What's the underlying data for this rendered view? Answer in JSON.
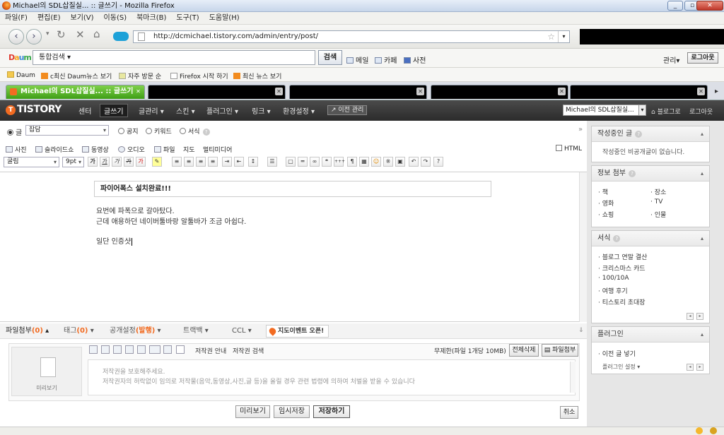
{
  "window": {
    "title": "Michael의 SDL삽질실... :: 글쓰기 - Mozilla Firefox"
  },
  "menu": [
    "파일(F)",
    "편집(E)",
    "보기(V)",
    "이동(S)",
    "북마크(B)",
    "도구(T)",
    "도움말(H)"
  ],
  "nav": {
    "url": "http://dcmichael.tistory.com/admin/entry/post/"
  },
  "daum": {
    "logo": "Daum",
    "search_label": "통합검색",
    "search_button": "검색",
    "links": [
      "메일",
      "카페",
      "사전"
    ],
    "manage": "관리",
    "logout": "로그아웃"
  },
  "bookmarks": [
    "Daum",
    "c최신 Daum뉴스 보기",
    "자주 방문 순",
    "Firefox 시작 하기",
    "최신 뉴스 보기"
  ],
  "tabs": {
    "active": "Michael의 SDL삽질실... :: 글쓰기"
  },
  "tistory": {
    "logo": "TISTORY",
    "nav": [
      "센터",
      "글쓰기",
      "글관리",
      "스킨",
      "플러그인",
      "링크",
      "환경설정"
    ],
    "old_manager": "이전 관리",
    "blog_select": "Michael의 SDL삽질실...",
    "blog_link": "블로그로",
    "logout": "로그아웃"
  },
  "editor": {
    "type_options": [
      "글",
      "공지",
      "키워드",
      "서식"
    ],
    "category": "잡담",
    "media": [
      "사진",
      "슬라이드쇼",
      "동영상",
      "오디오",
      "파일",
      "지도",
      "멀티미디어"
    ],
    "html_label": "HTML",
    "font": "굴림",
    "size": "9pt",
    "title": "파이어폭스 설치완료!!!",
    "body": [
      "요번에 파폭으로 갈아탔다.",
      "근데 애용하던 네이버툴바랑 알툴바가 조금 아쉽다.",
      "",
      "일단 인증샷"
    ]
  },
  "bottom_tabs": {
    "file": "파일첨부",
    "file_count": "(0)",
    "tag": "태그",
    "tag_count": "(0)",
    "visibility": "공개설정",
    "visibility_value": "(발행)",
    "trackback": "트랙백",
    "ccl": "CCL",
    "map_event": "지도이벤트 오픈!"
  },
  "attach": {
    "copyright_info": "저작권 안내",
    "copyright_search": "저작권 검색",
    "limit": "무제한(파일 1개당 10MB)",
    "delete_all": "전체삭제",
    "attach_file": "파일첨부",
    "preview": "미리보기",
    "notice": [
      "저작권을 보호해주세요.",
      "저작권자의 허락없이 임의로 저작물(음악,동영상,사진,글 등)을 올릴 경우 관련 법령에 의하여 처벌을 받을 수 있습니다"
    ]
  },
  "actions": {
    "preview": "미리보기",
    "temp_save": "임시저장",
    "save": "저장하기",
    "cancel": "취소"
  },
  "sidebar": {
    "writing": {
      "title": "작성중인 글",
      "empty": "작성중인 비공개글이 없습니다."
    },
    "info": {
      "title": "정보 첨부",
      "items": [
        "책",
        "장소",
        "영화",
        "TV",
        "쇼핑",
        "인물"
      ]
    },
    "template": {
      "title": "서식",
      "items": [
        "블로그 연말 결산",
        "크리스마스 카드",
        "100/10A",
        "여행 후기",
        "티스토리 초대장"
      ]
    },
    "plugin": {
      "title": "플러그인",
      "items": [
        "이전 글 넣기"
      ],
      "setting": "플러그인 설정"
    }
  }
}
